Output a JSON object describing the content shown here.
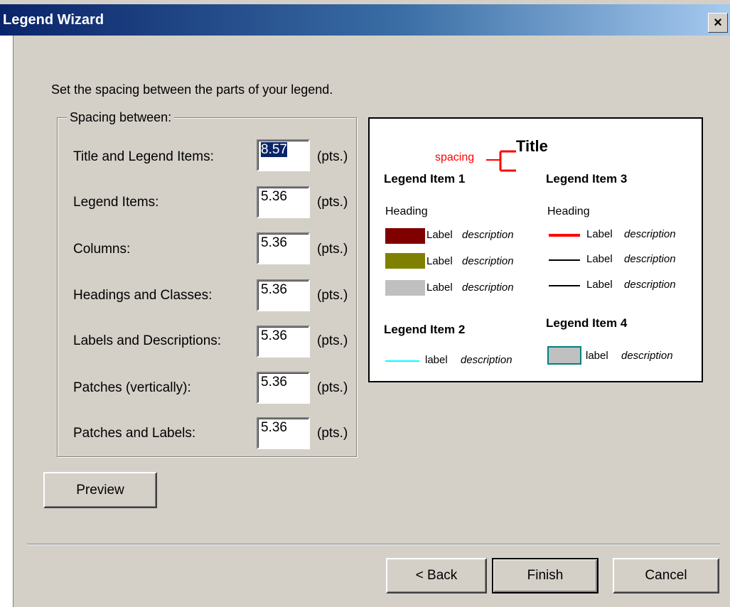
{
  "window": {
    "title": "Legend Wizard",
    "close_symbol": "×"
  },
  "instruction": "Set the spacing between the parts of your legend.",
  "spacing_group": {
    "label": "Spacing between:",
    "unit": "(pts.)",
    "rows": [
      {
        "label": "Title and Legend Items:",
        "value": "8.57",
        "selected": true
      },
      {
        "label": "Legend Items:",
        "value": "5.36"
      },
      {
        "label": "Columns:",
        "value": "5.36"
      },
      {
        "label": "Headings and Classes:",
        "value": "5.36"
      },
      {
        "label": "Labels and Descriptions:",
        "value": "5.36"
      },
      {
        "label": "Patches (vertically):",
        "value": "5.36"
      },
      {
        "label": "Patches and Labels:",
        "value": "5.36"
      }
    ]
  },
  "preview": {
    "title": "Title",
    "spacing_label": "spacing",
    "spacing_color": "#ff0000",
    "items": [
      {
        "name": "Legend Item 1",
        "heading": "Heading",
        "classes": [
          {
            "label": "Label",
            "description": "description",
            "patch_color": "#800000"
          },
          {
            "label": "Label",
            "description": "description",
            "patch_color": "#808000"
          },
          {
            "label": "Label",
            "description": "description",
            "patch_color": "#c0c0c0"
          }
        ]
      },
      {
        "name": "Legend Item 2",
        "classes": [
          {
            "label": "label",
            "description": "description",
            "line_color": "#00ffff"
          }
        ]
      },
      {
        "name": "Legend Item 3",
        "heading": "Heading",
        "classes": [
          {
            "label": "Label",
            "description": "description",
            "line_color": "#ff0000"
          },
          {
            "label": "Label",
            "description": "description",
            "line_color": "#000000"
          },
          {
            "label": "Label",
            "description": "description",
            "line_color": "#000000"
          }
        ]
      },
      {
        "name": "Legend Item 4",
        "classes": [
          {
            "label": "label",
            "description": "description",
            "patch_color": "#c0c0c0",
            "patch_border": "#008080"
          }
        ]
      }
    ]
  },
  "buttons": {
    "preview": "Preview",
    "back": "< Back",
    "finish": "Finish",
    "cancel": "Cancel"
  }
}
